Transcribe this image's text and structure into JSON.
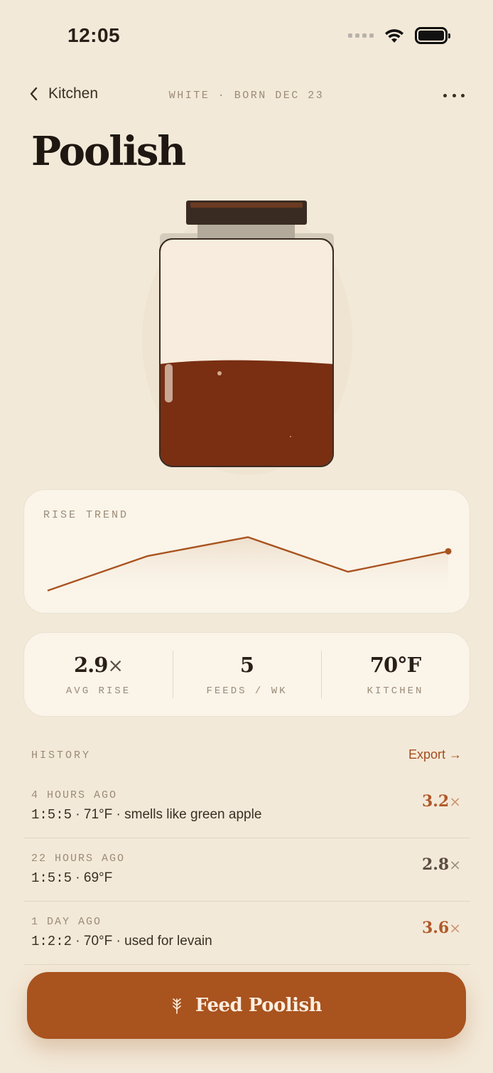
{
  "status_bar": {
    "time": "12:05"
  },
  "nav": {
    "back_label": "Kitchen",
    "meta": "WHITE · BORN DEC 23"
  },
  "page_title": "Poolish",
  "jar": {
    "fill_level": 0.45
  },
  "rise_trend": {
    "title": "RISE TREND",
    "values": [
      1.6,
      2.7,
      3.3,
      2.2,
      2.85
    ]
  },
  "stats": [
    {
      "value": "2.9",
      "unit": "×",
      "label": "AVG RISE"
    },
    {
      "value": "5",
      "unit": "",
      "label": "FEEDS / WK"
    },
    {
      "value": "70°F",
      "unit": "",
      "label": "KITCHEN"
    }
  ],
  "history": {
    "header": "HISTORY",
    "export_label": "Export →",
    "rows": [
      {
        "time": "4 HOURS AGO",
        "ratio": "1:5:5",
        "detail": " · 71°F · smells like green apple",
        "rise": "3.2",
        "rise_color": "#b0592a"
      },
      {
        "time": "22 HOURS AGO",
        "ratio": "1:5:5",
        "detail": " · 69°F",
        "rise": "2.8",
        "rise_color": "#5b4d41"
      },
      {
        "time": "1 DAY AGO",
        "ratio": "1:2:2",
        "detail": " · 70°F · used for levain",
        "rise": "3.6",
        "rise_color": "#b0592a"
      }
    ],
    "rise_suffix": "×"
  },
  "feed_button": {
    "label": "Feed Poolish",
    "icon": "wheat-icon"
  },
  "colors": {
    "accent": "#a9531f",
    "starter": "#7a2e12",
    "background": "#f3e9d8"
  }
}
